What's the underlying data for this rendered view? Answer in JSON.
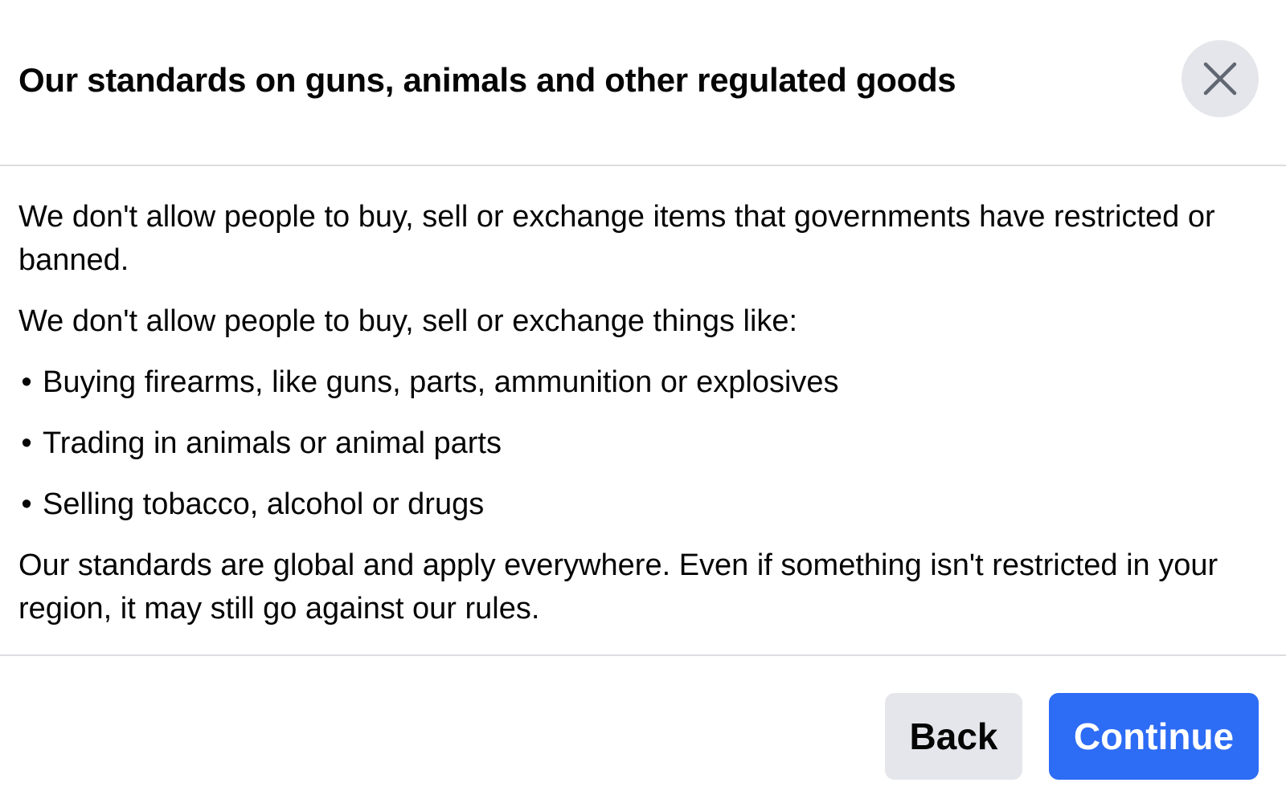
{
  "dialog": {
    "title": "Our standards on guns, animals and other regulated goods",
    "close_icon": "close-icon"
  },
  "content": {
    "intro": "We don't allow people to buy, sell or exchange items that governments have restricted or banned.",
    "list_heading": "We don't allow people to buy, sell or exchange things like:",
    "bullet_glyph": "•",
    "items": [
      {
        "label": "Buying firearms, like guns, parts, ammunition or explosives"
      },
      {
        "label": "Trading in animals or animal parts"
      },
      {
        "label": "Selling tobacco, alcohol or drugs"
      }
    ],
    "closing": "Our standards are global and apply everywhere. Even if something isn't restricted in your region, it may still go against our rules."
  },
  "footer": {
    "back_label": "Back",
    "continue_label": "Continue"
  },
  "colors": {
    "primary": "#2d6cf5",
    "secondary_button": "#e4e6eb",
    "divider": "#dcdde0",
    "text": "#050505"
  }
}
